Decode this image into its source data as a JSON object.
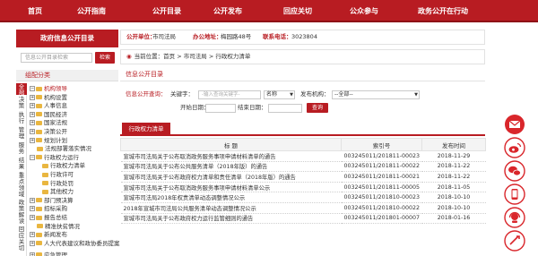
{
  "topnav": [
    "首页",
    "公开指南",
    "公开目录",
    "公开发布",
    "回应关切",
    "公众参与",
    "政务公开在行动"
  ],
  "sidebar": {
    "title": "政府信息公开目录",
    "search_placeholder": "信息公开目录检索",
    "search_button": "检索",
    "category_title": "组配分类",
    "vtabs": [
      "全部",
      "决策",
      "执行",
      "管理",
      "服务",
      "结果",
      "重点领域",
      "政策解读",
      "回应关切"
    ],
    "tree": [
      {
        "label": "机构领导",
        "icon": "minus",
        "red": true
      },
      {
        "label": "机构设置",
        "icon": "plus"
      },
      {
        "label": "人事信息",
        "icon": "plus"
      },
      {
        "label": "国民经济",
        "icon": "plus"
      },
      {
        "label": "国家法规",
        "icon": "plus"
      },
      {
        "label": "决策公开",
        "icon": "plus"
      },
      {
        "label": "规划计划",
        "icon": "plus"
      },
      {
        "label": "法规部署落实情况",
        "icon": "none"
      },
      {
        "label": "行政权力运行",
        "icon": "minus"
      },
      {
        "label": "行政权力清单",
        "icon": "child"
      },
      {
        "label": "行政许可",
        "icon": "child"
      },
      {
        "label": "行政处罚",
        "icon": "child"
      },
      {
        "label": "其他权力",
        "icon": "child"
      },
      {
        "label": "部门预决算",
        "icon": "plus"
      },
      {
        "label": "招标采购",
        "icon": "plus"
      },
      {
        "label": "报告总结",
        "icon": "plus"
      },
      {
        "label": "精准扶贫情况",
        "icon": "none"
      },
      {
        "label": "新闻发布",
        "icon": "plus"
      },
      {
        "label": "人大代表建议和政协委员提案",
        "icon": "plus"
      },
      {
        "label": "应急管理",
        "icon": "plus"
      },
      {
        "label": "政府信息公开工作专栏",
        "icon": "plus"
      }
    ]
  },
  "infobar": {
    "unit_label": "公开单位：",
    "unit": "市司法局",
    "addr_label": "办公地址：",
    "addr": "梅园路48号",
    "phone_label": "联系电话：",
    "phone": "3023804"
  },
  "breadcrumb": {
    "prefix": "当前位置：",
    "path": "首页 > 市司法局 > 行政权力清单"
  },
  "section_title": "信息公开目录",
  "query": {
    "title": "信息公开查询：",
    "keyword_label": "关键字：",
    "keyword_placeholder": "-输入查询关键字-",
    "field_value": "名称",
    "org_label": "发布机构：",
    "org_value": "--全部--",
    "start_label": "开始日期：",
    "end_label": "结束日期：",
    "button": "查询"
  },
  "tab_label": "行政权力清单",
  "table": {
    "headers": [
      "标  题",
      "索引号",
      "发布时间"
    ],
    "rows": [
      [
        "宣城市司法局关于公布取消政务服务事项申请材料清单的通告",
        "003245011/201811-00023",
        "2018-11-29"
      ],
      [
        "宣城市司法局关于公布公共服务清单（2018年版）的通告",
        "003245011/201811-00022",
        "2018-11-22"
      ],
      [
        "宣城市司法局关于公布政府权力清单和责任清单（2018年版）的通告",
        "003245011/201811-00021",
        "2018-11-22"
      ],
      [
        "宣城市司法局关于公布取消政务服务事项申请材料清单公示",
        "003245011/201811-00005",
        "2018-11-05"
      ],
      [
        "宣城市司法局2018年权责清单动态调整情况公示",
        "003245011/201810-00023",
        "2018-10-10"
      ],
      [
        "2018年宣城市司法局公共服务清单动态调整情况公示",
        "003245011/201810-00022",
        "2018-10-10"
      ],
      [
        "宣城市司法局关于公布政府权力运行监管细则的通告",
        "003245011/201801-00007",
        "2018-01-16"
      ]
    ]
  },
  "sidetools": [
    "mail-icon",
    "weibo-icon",
    "wechat-icon",
    "mobile-icon",
    "headset-icon",
    "feedback-icon"
  ],
  "colors": {
    "brand_red": "#b81c22",
    "folder": "#e9b640"
  }
}
